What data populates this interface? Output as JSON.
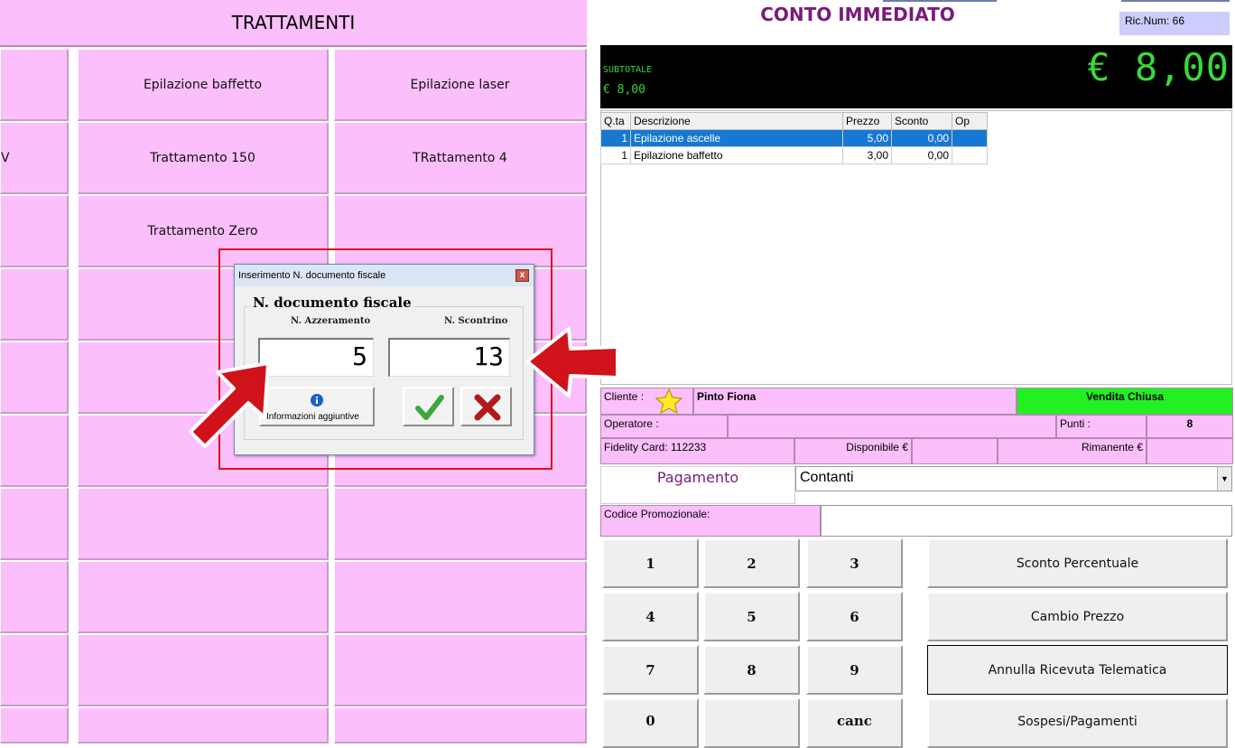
{
  "left_panel": {
    "header": "TRATTAMENTI",
    "tiles_row1": [
      "",
      "Epilazione baffetto",
      "Epilazione laser"
    ],
    "tiles_row2": [
      "V",
      "Trattamento 150",
      "TRattamento 4"
    ],
    "tiles_row3": [
      "",
      "Trattamento Zero",
      ""
    ]
  },
  "header": {
    "title": "CONTO IMMEDIATO",
    "ric_num": "Ric.Num: 66"
  },
  "display": {
    "subtotal_label": "SUBTOTALE",
    "subtotal_value": "€ 8,00",
    "total": "€ 8,00"
  },
  "items_table": {
    "columns": [
      "Q.ta",
      "Descrizione",
      "Prezzo",
      "Sconto",
      "Op"
    ],
    "rows": [
      {
        "qty": "1",
        "desc": "Epilazione ascelle",
        "price": "5,00",
        "discount": "0,00",
        "op": "",
        "selected": true
      },
      {
        "qty": "1",
        "desc": "Epilazione baffetto",
        "price": "3,00",
        "discount": "0,00",
        "op": "",
        "selected": false
      }
    ]
  },
  "customer": {
    "cliente_label": "Cliente :",
    "cliente_name": "Pinto Fiona",
    "status": "Vendita Chiusa",
    "status_color": "#22f022",
    "operatore_label": "Operatore :",
    "operatore_value": "",
    "punti_label": "Punti :",
    "punti_value": "8",
    "fidelity": "Fidelity Card: 112233",
    "disponibile_label": "Disponibile €",
    "rimanente_label": "Rimanente €"
  },
  "payment": {
    "label": "Pagamento",
    "method": "Contanti",
    "promo_label": "Codice Promozionale:",
    "promo_value": ""
  },
  "keypad": {
    "k1": "1",
    "k2": "2",
    "k3": "3",
    "k4": "4",
    "k5": "5",
    "k6": "6",
    "k7": "7",
    "k8": "8",
    "k9": "9",
    "k0": "0",
    "kcanc": "canc"
  },
  "actions": {
    "sconto": "Sconto Percentuale",
    "cambio": "Cambio Prezzo",
    "annulla": "Annulla Ricevuta Telematica",
    "sospesi": "Sospesi/Pagamenti"
  },
  "dialog": {
    "title": "Inserimento N. documento fiscale",
    "close": "x",
    "group_title": "N. documento fiscale",
    "azzeramento_label": "N. Azzeramento",
    "azzeramento_value": "5",
    "scontrino_label": "N. Scontrino",
    "scontrino_value": "13",
    "info_label": "Informazioni aggiuntive",
    "info_icon": "info-icon",
    "confirm_icon": "check-icon",
    "cancel_icon": "x-icon"
  },
  "colors": {
    "tile_pink": "#fbbffb",
    "title_purple": "#7a1a7a",
    "display_green": "#3bd93b",
    "highlight_red": "#e0111c",
    "selection_blue": "#1778d2"
  }
}
